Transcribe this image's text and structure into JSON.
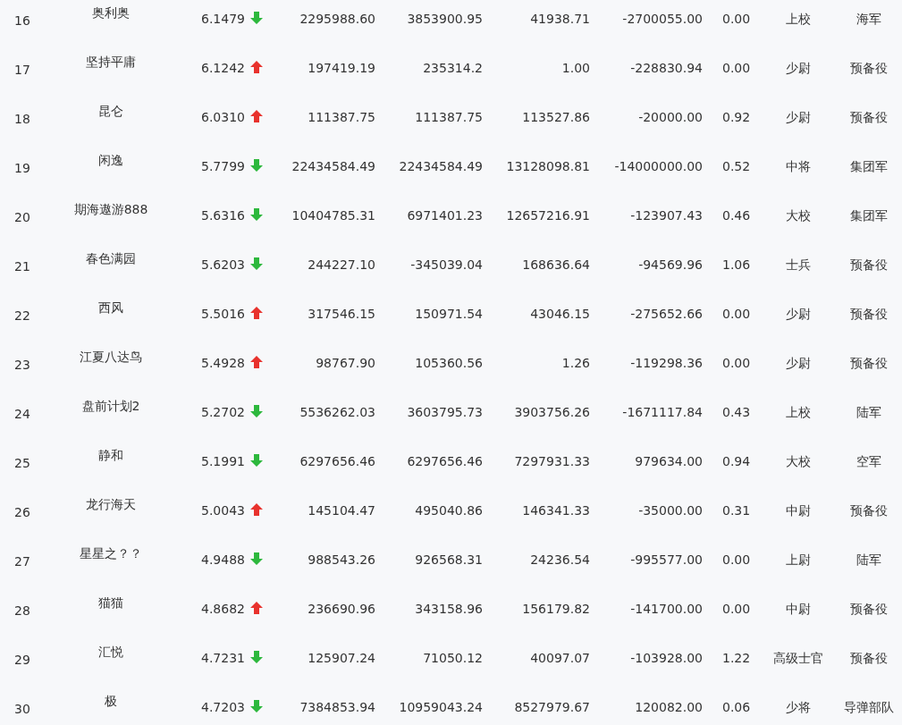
{
  "rows": [
    {
      "rank": "16",
      "name": "奥利奥",
      "score": "6.1479",
      "rising": false,
      "col_4": "2295988.60",
      "col_5": "3853900.95",
      "col_6": "41938.71",
      "col_7": "-2700055.00",
      "col_8": "0.00",
      "title": "上校",
      "branch": "海军"
    },
    {
      "rank": "17",
      "name": "坚持平庸",
      "score": "6.1242",
      "rising": true,
      "col_4": "197419.19",
      "col_5": "235314.2",
      "col_6": "1.00",
      "col_7": "-228830.94",
      "col_8": "0.00",
      "title": "少尉",
      "branch": "预备役"
    },
    {
      "rank": "18",
      "name": "昆仑",
      "score": "6.0310",
      "rising": true,
      "col_4": "111387.75",
      "col_5": "111387.75",
      "col_6": "113527.86",
      "col_7": "-20000.00",
      "col_8": "0.92",
      "title": "少尉",
      "branch": "预备役"
    },
    {
      "rank": "19",
      "name": "闲逸",
      "score": "5.7799",
      "rising": false,
      "col_4": "22434584.49",
      "col_5": "22434584.49",
      "col_6": "13128098.81",
      "col_7": "-14000000.00",
      "col_8": "0.52",
      "title": "中将",
      "branch": "集团军"
    },
    {
      "rank": "20",
      "name": "期海遨游888",
      "score": "5.6316",
      "rising": false,
      "col_4": "10404785.31",
      "col_5": "6971401.23",
      "col_6": "12657216.91",
      "col_7": "-123907.43",
      "col_8": "0.46",
      "title": "大校",
      "branch": "集团军"
    },
    {
      "rank": "21",
      "name": "春色满园",
      "score": "5.6203",
      "rising": false,
      "col_4": "244227.10",
      "col_5": "-345039.04",
      "col_6": "168636.64",
      "col_7": "-94569.96",
      "col_8": "1.06",
      "title": "士兵",
      "branch": "预备役"
    },
    {
      "rank": "22",
      "name": "西风",
      "score": "5.5016",
      "rising": true,
      "col_4": "317546.15",
      "col_5": "150971.54",
      "col_6": "43046.15",
      "col_7": "-275652.66",
      "col_8": "0.00",
      "title": "少尉",
      "branch": "预备役"
    },
    {
      "rank": "23",
      "name": "江夏八达鸟",
      "score": "5.4928",
      "rising": true,
      "col_4": "98767.90",
      "col_5": "105360.56",
      "col_6": "1.26",
      "col_7": "-119298.36",
      "col_8": "0.00",
      "title": "少尉",
      "branch": "预备役"
    },
    {
      "rank": "24",
      "name": "盘前计划2",
      "score": "5.2702",
      "rising": false,
      "col_4": "5536262.03",
      "col_5": "3603795.73",
      "col_6": "3903756.26",
      "col_7": "-1671117.84",
      "col_8": "0.43",
      "title": "上校",
      "branch": "陆军"
    },
    {
      "rank": "25",
      "name": "静和",
      "score": "5.1991",
      "rising": false,
      "col_4": "6297656.46",
      "col_5": "6297656.46",
      "col_6": "7297931.33",
      "col_7": "979634.00",
      "col_8": "0.94",
      "title": "大校",
      "branch": "空军"
    },
    {
      "rank": "26",
      "name": "龙行海天",
      "score": "5.0043",
      "rising": true,
      "col_4": "145104.47",
      "col_5": "495040.86",
      "col_6": "146341.33",
      "col_7": "-35000.00",
      "col_8": "0.31",
      "title": "中尉",
      "branch": "预备役"
    },
    {
      "rank": "27",
      "name": "星星之？？",
      "score": "4.9488",
      "rising": false,
      "col_4": "988543.26",
      "col_5": "926568.31",
      "col_6": "24236.54",
      "col_7": "-995577.00",
      "col_8": "0.00",
      "title": "上尉",
      "branch": "陆军"
    },
    {
      "rank": "28",
      "name": "猫猫",
      "score": "4.8682",
      "rising": true,
      "col_4": "236690.96",
      "col_5": "343158.96",
      "col_6": "156179.82",
      "col_7": "-141700.00",
      "col_8": "0.00",
      "title": "中尉",
      "branch": "预备役"
    },
    {
      "rank": "29",
      "name": "汇悦",
      "score": "4.7231",
      "rising": false,
      "col_4": "125907.24",
      "col_5": "71050.12",
      "col_6": "40097.07",
      "col_7": "-103928.00",
      "col_8": "1.22",
      "title": "高级士官",
      "branch": "预备役"
    },
    {
      "rank": "30",
      "name": "极",
      "score": "4.7203",
      "rising": false,
      "col_4": "7384853.94",
      "col_5": "10959043.24",
      "col_6": "8527979.67",
      "col_7": "120082.00",
      "col_8": "0.06",
      "title": "少将",
      "branch": "导弹部队"
    }
  ]
}
